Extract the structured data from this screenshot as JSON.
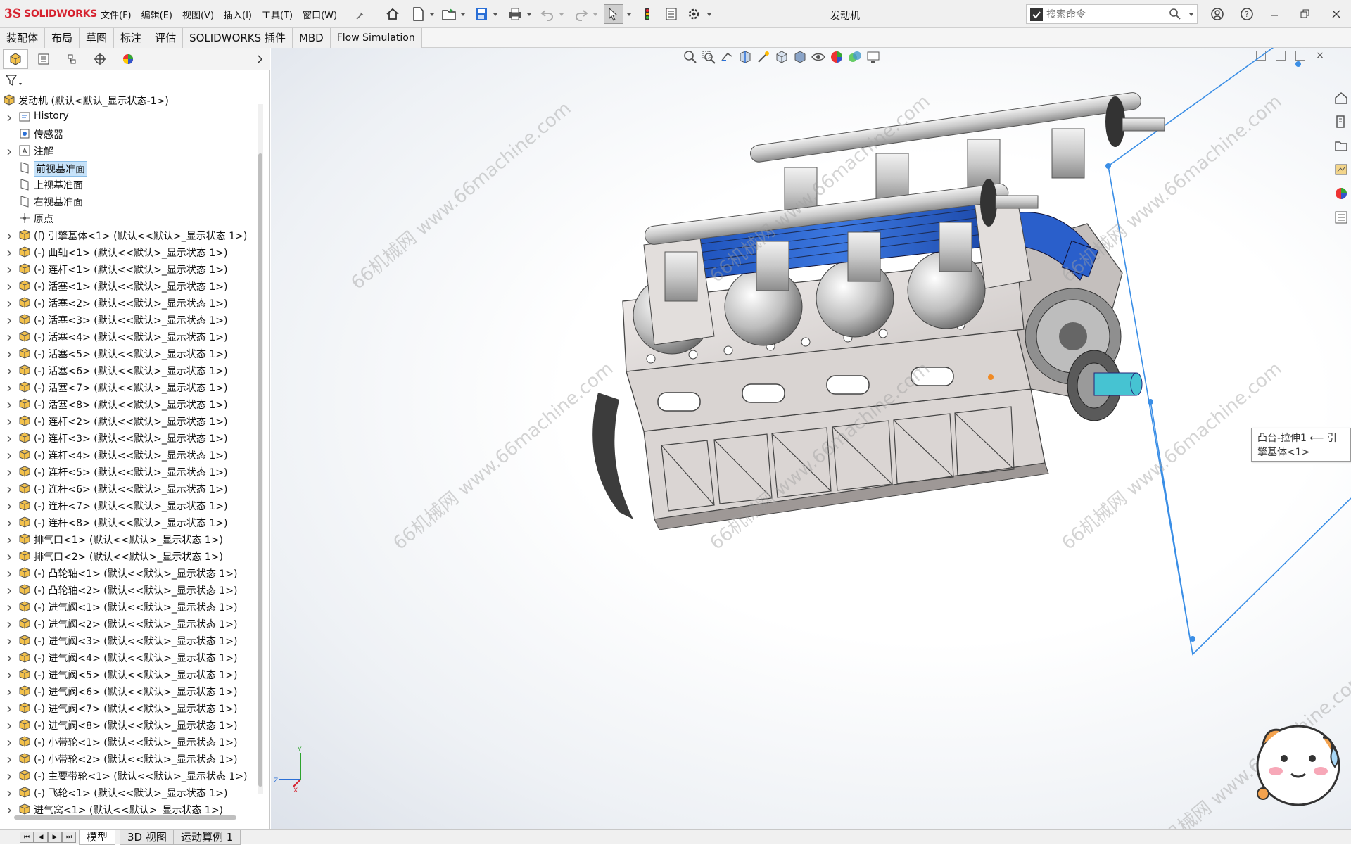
{
  "app": {
    "brand_ds": "3S",
    "brand_name": "SOLIDWORKS",
    "doc_title": "发动机"
  },
  "menu": [
    "文件(F)",
    "编辑(E)",
    "视图(V)",
    "插入(I)",
    "工具(T)",
    "窗口(W)"
  ],
  "search": {
    "placeholder": "搜索命令"
  },
  "command_tabs": [
    "装配体",
    "布局",
    "草图",
    "标注",
    "评估",
    "SOLIDWORKS 插件",
    "MBD",
    "Flow Simulation"
  ],
  "tree": {
    "root": "发动机 (默认<默认_显示状态-1>)",
    "items": [
      {
        "label": "History",
        "kind": "history"
      },
      {
        "label": "传感器",
        "kind": "sensor"
      },
      {
        "label": "注解",
        "kind": "annotation"
      },
      {
        "label": "前视基准面",
        "kind": "plane",
        "selected": true
      },
      {
        "label": "上视基准面",
        "kind": "plane"
      },
      {
        "label": "右视基准面",
        "kind": "plane"
      },
      {
        "label": "原点",
        "kind": "origin"
      },
      {
        "label": "(f) 引擎基体<1> (默认<<默认>_显示状态 1>)",
        "kind": "part"
      },
      {
        "label": "(-) 曲轴<1> (默认<<默认>_显示状态 1>)",
        "kind": "part"
      },
      {
        "label": "(-) 连杆<1> (默认<<默认>_显示状态 1>)",
        "kind": "part"
      },
      {
        "label": "(-) 活塞<1> (默认<<默认>_显示状态 1>)",
        "kind": "part"
      },
      {
        "label": "(-) 活塞<2> (默认<<默认>_显示状态 1>)",
        "kind": "part"
      },
      {
        "label": "(-) 活塞<3> (默认<<默认>_显示状态 1>)",
        "kind": "part"
      },
      {
        "label": "(-) 活塞<4> (默认<<默认>_显示状态 1>)",
        "kind": "part"
      },
      {
        "label": "(-) 活塞<5> (默认<<默认>_显示状态 1>)",
        "kind": "part"
      },
      {
        "label": "(-) 活塞<6> (默认<<默认>_显示状态 1>)",
        "kind": "part"
      },
      {
        "label": "(-) 活塞<7> (默认<<默认>_显示状态 1>)",
        "kind": "part"
      },
      {
        "label": "(-) 活塞<8> (默认<<默认>_显示状态 1>)",
        "kind": "part"
      },
      {
        "label": "(-) 连杆<2> (默认<<默认>_显示状态 1>)",
        "kind": "part"
      },
      {
        "label": "(-) 连杆<3> (默认<<默认>_显示状态 1>)",
        "kind": "part"
      },
      {
        "label": "(-) 连杆<4> (默认<<默认>_显示状态 1>)",
        "kind": "part"
      },
      {
        "label": "(-) 连杆<5> (默认<<默认>_显示状态 1>)",
        "kind": "part"
      },
      {
        "label": "(-) 连杆<6> (默认<<默认>_显示状态 1>)",
        "kind": "part"
      },
      {
        "label": "(-) 连杆<7> (默认<<默认>_显示状态 1>)",
        "kind": "part"
      },
      {
        "label": "(-) 连杆<8> (默认<<默认>_显示状态 1>)",
        "kind": "part"
      },
      {
        "label": "排气口<1> (默认<<默认>_显示状态 1>)",
        "kind": "part"
      },
      {
        "label": "排气口<2> (默认<<默认>_显示状态 1>)",
        "kind": "part"
      },
      {
        "label": "(-) 凸轮轴<1> (默认<<默认>_显示状态 1>)",
        "kind": "part"
      },
      {
        "label": "(-) 凸轮轴<2> (默认<<默认>_显示状态 1>)",
        "kind": "part"
      },
      {
        "label": "(-) 进气阀<1> (默认<<默认>_显示状态 1>)",
        "kind": "part"
      },
      {
        "label": "(-) 进气阀<2> (默认<<默认>_显示状态 1>)",
        "kind": "part"
      },
      {
        "label": "(-) 进气阀<3> (默认<<默认>_显示状态 1>)",
        "kind": "part"
      },
      {
        "label": "(-) 进气阀<4> (默认<<默认>_显示状态 1>)",
        "kind": "part"
      },
      {
        "label": "(-) 进气阀<5> (默认<<默认>_显示状态 1>)",
        "kind": "part"
      },
      {
        "label": "(-) 进气阀<6> (默认<<默认>_显示状态 1>)",
        "kind": "part"
      },
      {
        "label": "(-) 进气阀<7> (默认<<默认>_显示状态 1>)",
        "kind": "part"
      },
      {
        "label": "(-) 进气阀<8> (默认<<默认>_显示状态 1>)",
        "kind": "part"
      },
      {
        "label": "(-) 小带轮<1> (默认<<默认>_显示状态 1>)",
        "kind": "part"
      },
      {
        "label": "(-) 小带轮<2> (默认<<默认>_显示状态 1>)",
        "kind": "part"
      },
      {
        "label": "(-) 主要带轮<1> (默认<<默认>_显示状态 1>)",
        "kind": "part"
      },
      {
        "label": "(-) 飞轮<1> (默认<<默认>_显示状态 1>)",
        "kind": "part"
      },
      {
        "label": "进气窝<1> (默认<<默认>_显示状态 1>)",
        "kind": "part"
      }
    ]
  },
  "tooltip": "凸台-拉伸1 ⟵ 引擎基体<1>",
  "bottom_tabs": [
    "模型",
    "3D 视图",
    "运动算例 1"
  ],
  "watermark": [
    "66机械网 www.66machine.com"
  ],
  "colors": {
    "accent_blue": "#2a6fd6",
    "brand_red": "#d6212e",
    "selection": "#c6e2f9",
    "plane_line": "#4a90e2"
  }
}
